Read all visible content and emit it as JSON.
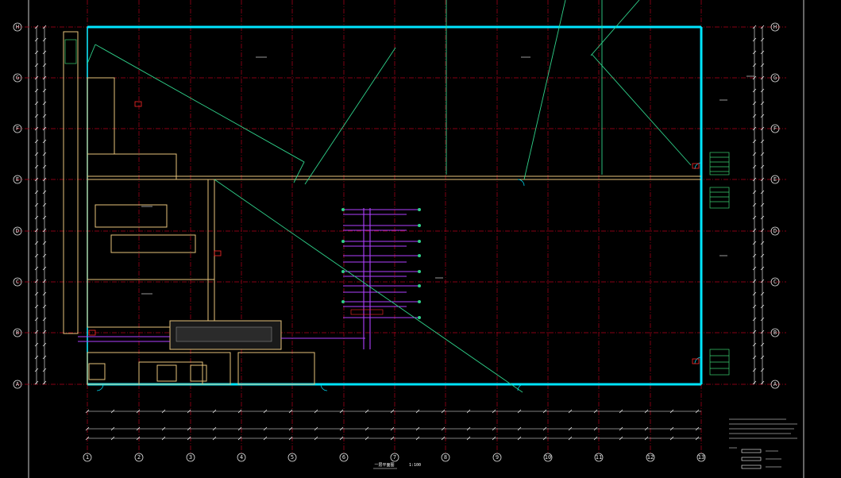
{
  "grid_axes": {
    "columns": [
      "1",
      "2",
      "3",
      "4",
      "5",
      "6",
      "7",
      "8",
      "9",
      "10",
      "11",
      "12",
      "13"
    ],
    "rows": [
      "A",
      "B",
      "C",
      "D",
      "E",
      "F",
      "G",
      "H"
    ]
  },
  "colors": {
    "background": "#000000",
    "axis_line": "#b3001b",
    "wall": "#e6c27a",
    "glazing": "#00e5ff",
    "sprinkler_pipe": "#b040ff",
    "leader": "#2fd18a",
    "dimension": "#ffffff",
    "annotation_red": "#ff2a2a",
    "stair": "#3bd16f"
  },
  "drawing_title": "一层平面图",
  "scale_label": "1:100",
  "sheet_note": "…",
  "notes_heading": "…",
  "legend_items": [
    "…",
    "…",
    "…",
    "…"
  ],
  "icons": [
    "door-swing-icon",
    "stair-icon",
    "fire-hydrant-icon",
    "grid-bubble-icon"
  ]
}
